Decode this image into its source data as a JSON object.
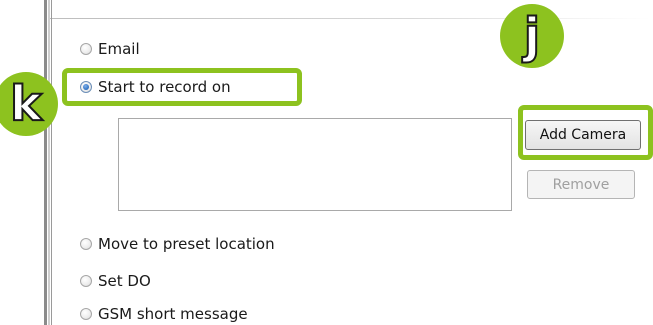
{
  "options": {
    "email": "Email",
    "start_record": "Start to record on",
    "move_preset": "Move to preset location",
    "set_do": "Set DO",
    "gsm": "GSM short message"
  },
  "buttons": {
    "add_camera": "Add Camera",
    "remove": "Remove"
  },
  "callouts": {
    "j": "j",
    "k": "k"
  },
  "colors": {
    "callout_green": "#8dc21f",
    "radio_selected": "#2d6fc0"
  }
}
